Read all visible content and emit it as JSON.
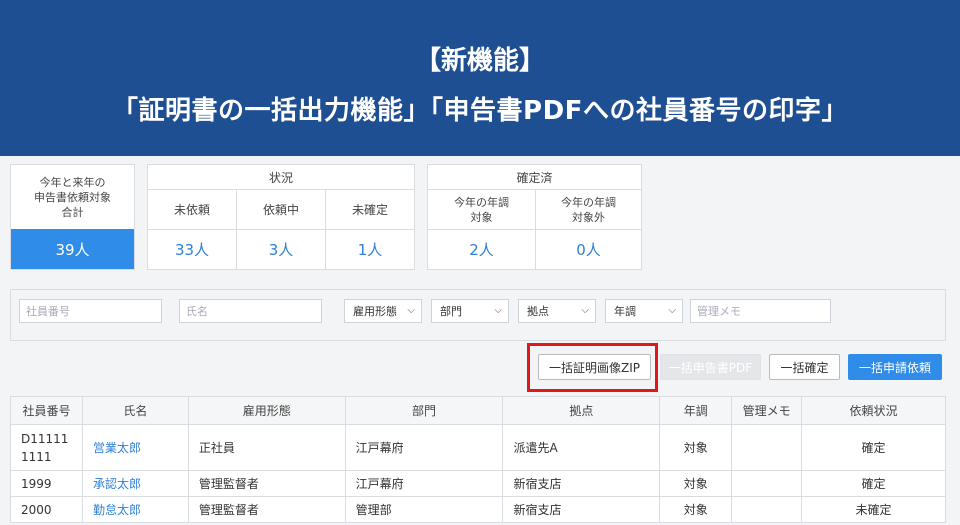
{
  "banner": {
    "line1": "【新機能】",
    "line2": "「証明書の一括出力機能」「申告書PDFへの社員番号の印字」"
  },
  "summary": {
    "total_label": "今年と来年の\n申告書依頼対象\n合計",
    "total_value": "39人",
    "status": {
      "header": "状況",
      "items": [
        {
          "label": "未依頼",
          "value": "33人"
        },
        {
          "label": "依頼中",
          "value": "3人"
        },
        {
          "label": "未確定",
          "value": "1人"
        }
      ]
    },
    "confirmed": {
      "header": "確定済",
      "items": [
        {
          "label": "今年の年調\n対象",
          "value": "2人"
        },
        {
          "label": "今年の年調\n対象外",
          "value": "0人"
        }
      ]
    }
  },
  "filters": {
    "employee_no_placeholder": "社員番号",
    "name_placeholder": "氏名",
    "employment_type": "雇用形態",
    "department": "部門",
    "location": "拠点",
    "year_end": "年調",
    "memo_placeholder": "管理メモ"
  },
  "actions": {
    "zip": "一括証明画像ZIP",
    "pdf": "一括申告書PDF",
    "confirm": "一括確定",
    "request": "一括申請依頼"
  },
  "table": {
    "headers": [
      "社員番号",
      "氏名",
      "雇用形態",
      "部門",
      "拠点",
      "年調",
      "管理メモ",
      "依頼状況"
    ],
    "rows": [
      {
        "no": "D11111\n1111",
        "name": "営業太郎",
        "type": "正社員",
        "dept": "江戸幕府",
        "loc": "派遣先A",
        "nencho": "対象",
        "memo": "",
        "status": "確定"
      },
      {
        "no": "1999",
        "name": "承認太郎",
        "type": "管理監督者",
        "dept": "江戸幕府",
        "loc": "新宿支店",
        "nencho": "対象",
        "memo": "",
        "status": "確定"
      },
      {
        "no": "2000",
        "name": "勤怠太郎",
        "type": "管理監督者",
        "dept": "管理部",
        "loc": "新宿支店",
        "nencho": "対象",
        "memo": "",
        "status": "未確定"
      }
    ]
  },
  "colors": {
    "banner": "#1f4f93",
    "accent": "#2f8ce8",
    "highlight": "#e0171b"
  }
}
